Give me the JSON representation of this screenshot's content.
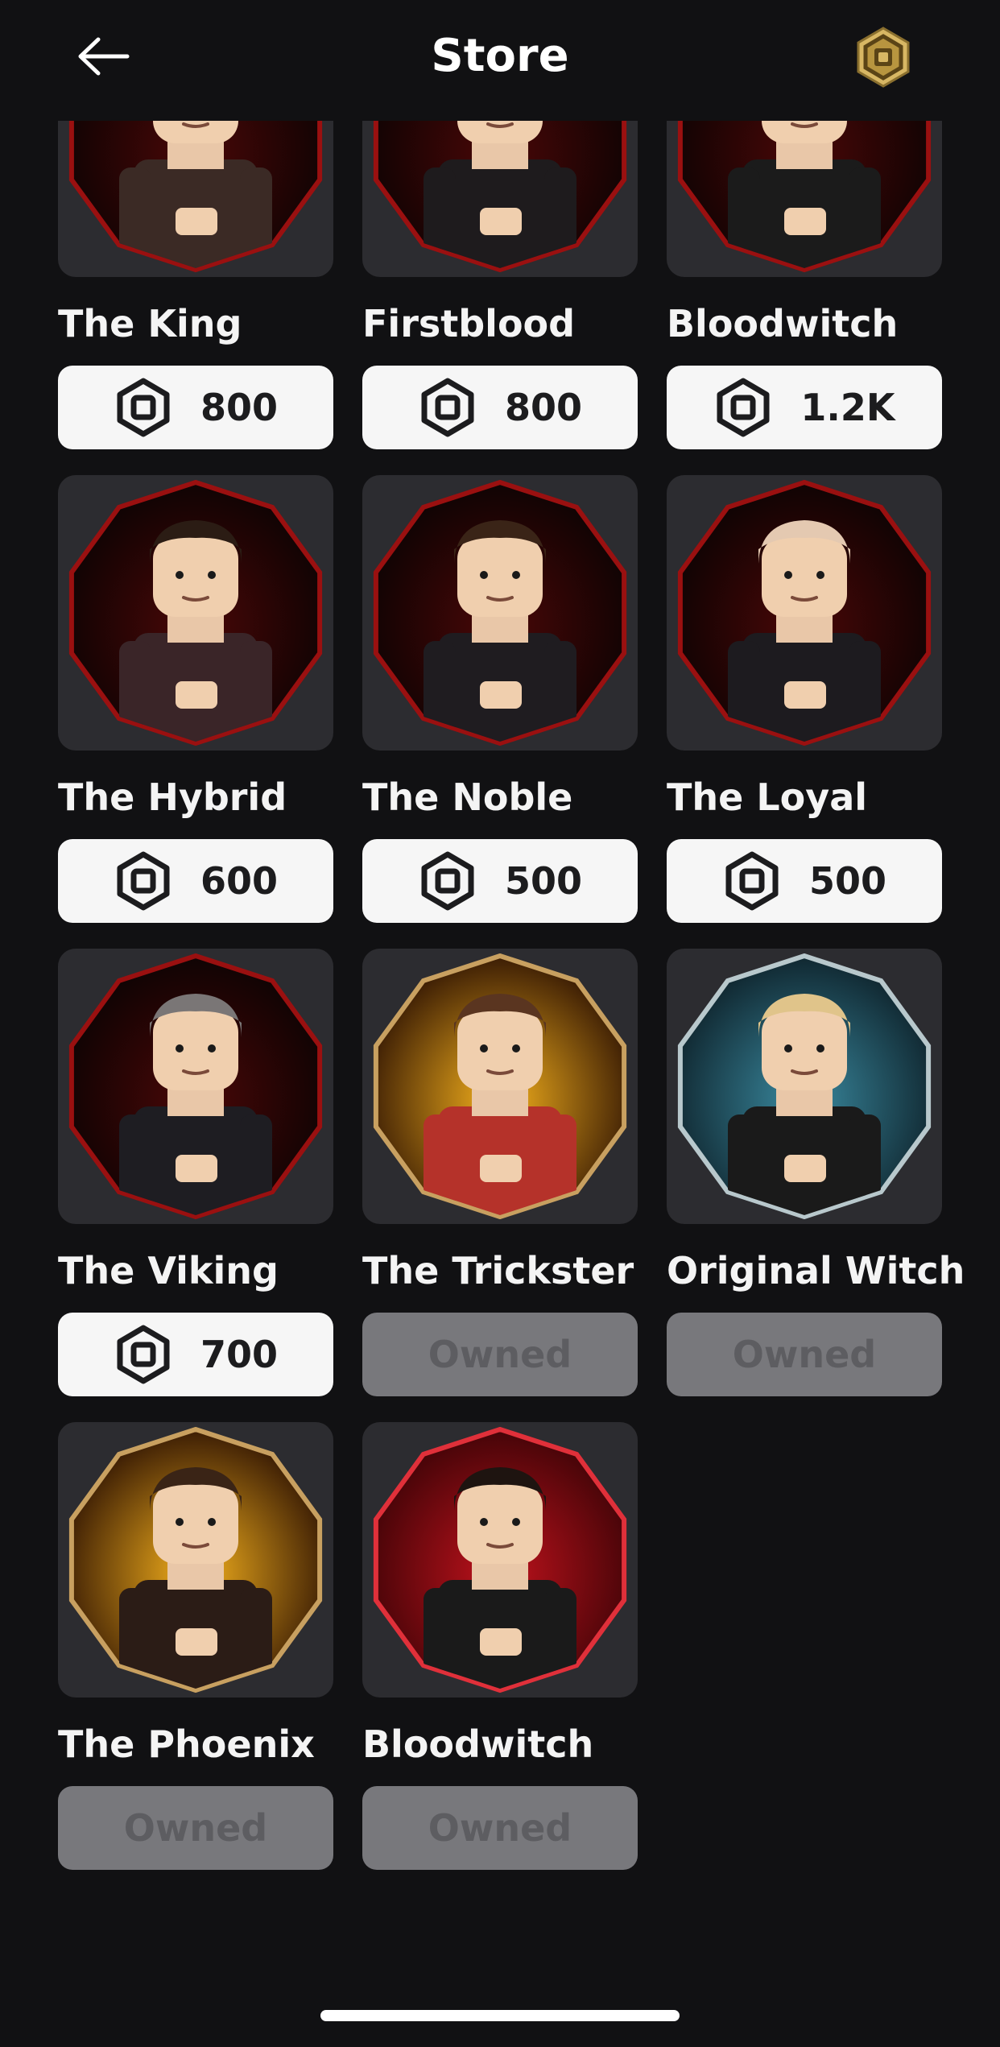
{
  "header": {
    "title": "Store",
    "back_icon": "arrow-left-icon",
    "currency_icon": "robux-gold-icon"
  },
  "colors": {
    "background": "#111113",
    "card": "#2c2c30",
    "price_button": "#f6f6f6",
    "owned_button": "#78787c",
    "ember": "#b31414",
    "fire": "#f59a1c",
    "ice": "#2f6f84",
    "gold": "#d8b764"
  },
  "items": [
    {
      "name": "The King",
      "price": "800",
      "owned": false,
      "theme": "red",
      "hair": "#2a1a12",
      "top": "#3b2a25"
    },
    {
      "name": "Firstblood",
      "price": "800",
      "owned": false,
      "theme": "red",
      "hair": "#2a1a12",
      "top": "#1e1b1d"
    },
    {
      "name": "Bloodwitch",
      "price": "1.2K",
      "owned": false,
      "theme": "red",
      "hair": "#4b2e22",
      "top": "#1b1b1b"
    },
    {
      "name": "The Hybrid",
      "price": "600",
      "owned": false,
      "theme": "red",
      "hair": "#2b1c14",
      "top": "#3a2528"
    },
    {
      "name": "The Noble",
      "price": "500",
      "owned": false,
      "theme": "red",
      "hair": "#3a2417",
      "top": "#1f1c20"
    },
    {
      "name": "The Loyal",
      "price": "500",
      "owned": false,
      "theme": "red",
      "hair": "#e4c9b1",
      "top": "#1d1b1f"
    },
    {
      "name": "The Viking",
      "price": "700",
      "owned": false,
      "theme": "red",
      "hair": "#7a7676",
      "top": "#1e1d22"
    },
    {
      "name": "The Trickster",
      "price": "Owned",
      "owned": true,
      "theme": "fire",
      "hair": "#5a3520",
      "top": "#b5322a"
    },
    {
      "name": "Original Witch",
      "price": "Owned",
      "owned": true,
      "theme": "ice",
      "hair": "#e0c48a",
      "top": "#1a1a1a"
    },
    {
      "name": "The Phoenix",
      "price": "Owned",
      "owned": true,
      "theme": "fire",
      "hair": "#3a2416",
      "top": "#2b1c16"
    },
    {
      "name": "Bloodwitch",
      "price": "Owned",
      "owned": true,
      "theme": "redbright",
      "hair": "#1e1410",
      "top": "#1a1a1a"
    }
  ]
}
